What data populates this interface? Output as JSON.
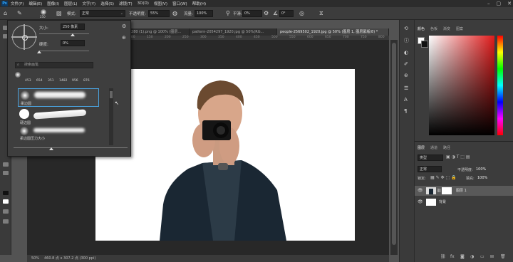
{
  "app": {
    "logo": "Ps"
  },
  "menu": [
    "文件(F)",
    "编辑(E)",
    "图像(I)",
    "图层(L)",
    "文字(Y)",
    "选择(S)",
    "滤镜(T)",
    "3D(D)",
    "视图(V)",
    "窗口(W)",
    "帮助(H)"
  ],
  "window_controls": {
    "min": "–",
    "max": "▢",
    "close": "✕"
  },
  "options": {
    "mode_label": "模式:",
    "mode_value": "正常",
    "opacity_label": "不透明度:",
    "opacity_value": "55%",
    "flow_label": "流量:",
    "flow_value": "100%",
    "smooth_label": "平滑:",
    "smooth_value": "0%",
    "angle_value": "0°",
    "brush_size_small": "250"
  },
  "tabs": [
    {
      "label": "46_1280 (1).png @ 100% (图层...",
      "active": false
    },
    {
      "label": "pattern-2054297_1920.jpg @ 50%(RG...",
      "active": false
    },
    {
      "label": "people-2569502_1920.jpg @ 50% (图层 1, 图层蒙版/8) *",
      "active": true
    }
  ],
  "ruler": [
    "100",
    "150",
    "200",
    "250",
    "300",
    "350",
    "400",
    "450",
    "500",
    "550",
    "600",
    "650",
    "700",
    "750",
    "800"
  ],
  "brush_panel": {
    "size_label": "大小:",
    "size_value": "250 像素",
    "hardness_label": "硬度:",
    "hardness_value": "0%",
    "search_placeholder": "搜索画笔",
    "preset_sizes": [
      "453",
      "654",
      "351",
      "1482",
      "956",
      "876"
    ],
    "presets": [
      {
        "label": "柔边圆"
      },
      {
        "label": "硬边圆"
      },
      {
        "label": "柔边圆压力大小"
      }
    ]
  },
  "status": {
    "zoom": "50%",
    "info": "460.8 点 x 307.2 点 (300 ppi)"
  },
  "color_panel": {
    "tabs": [
      "颜色",
      "色板",
      "渐变",
      "图案"
    ]
  },
  "layers_panel": {
    "tabs": [
      "图层",
      "通道",
      "路径"
    ],
    "filter_label": "类型",
    "blend_mode": "正常",
    "opacity_label": "不透明度:",
    "opacity_value": "100%",
    "lock_label": "锁定:",
    "fill_label": "填充:",
    "fill_value": "100%",
    "layers": [
      {
        "name": "图层 1",
        "selected": true
      },
      {
        "name": "背景",
        "selected": false
      }
    ]
  }
}
